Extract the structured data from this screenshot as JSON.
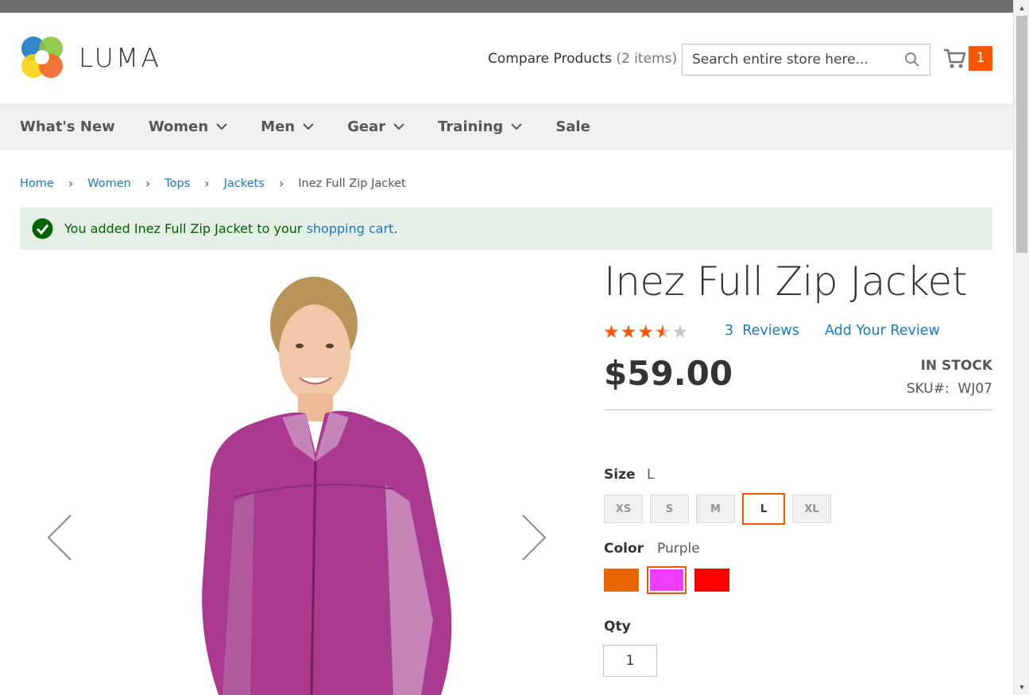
{
  "header": {
    "logo_text": "LUMA",
    "compare_label": "Compare Products",
    "compare_count": "(2 items)",
    "search_placeholder": "Search entire store here...",
    "cart_count": "1"
  },
  "nav": {
    "items": [
      {
        "label": "What's New",
        "has_dropdown": false
      },
      {
        "label": "Women",
        "has_dropdown": true
      },
      {
        "label": "Men",
        "has_dropdown": true
      },
      {
        "label": "Gear",
        "has_dropdown": true
      },
      {
        "label": "Training",
        "has_dropdown": true
      },
      {
        "label": "Sale",
        "has_dropdown": false
      }
    ]
  },
  "breadcrumbs": {
    "items": [
      "Home",
      "Women",
      "Tops",
      "Jackets"
    ],
    "current": "Inez Full Zip Jacket"
  },
  "message": {
    "prefix": "You added Inez Full Zip Jacket to your ",
    "link": "shopping cart",
    "suffix": "."
  },
  "product": {
    "title": "Inez Full Zip Jacket",
    "rating": 3.5,
    "rating_max": 5,
    "reviews_count": "3",
    "reviews_label": "Reviews",
    "add_review": "Add Your Review",
    "price": "$59.00",
    "stock": "IN STOCK",
    "sku_label": "SKU#:",
    "sku": "WJ07"
  },
  "options": {
    "size_label": "Size",
    "size_selected": "L",
    "sizes": [
      "XS",
      "S",
      "M",
      "L",
      "XL"
    ],
    "color_label": "Color",
    "color_selected": "Purple",
    "colors": [
      {
        "name": "Orange",
        "hex": "#eb6703"
      },
      {
        "name": "Purple",
        "hex": "#ef3dff"
      },
      {
        "name": "Red",
        "hex": "#ff0000"
      }
    ],
    "qty_label": "Qty",
    "qty_value": "1"
  },
  "colors": {
    "accent": "#ff5501",
    "link": "#1979c3",
    "success_bg": "#e5efe5",
    "success_text": "#006400"
  }
}
